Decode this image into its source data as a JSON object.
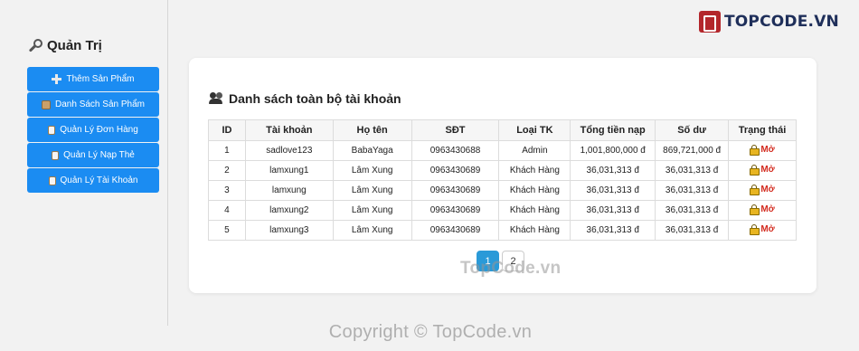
{
  "logo": {
    "text": "TOPCODE.VN"
  },
  "sidebar": {
    "title": "Quản Trị",
    "items": [
      {
        "label": "Thêm Sản Phẩm",
        "icon": "plus-icon"
      },
      {
        "label": "Danh Sách Sản Phẩm",
        "icon": "box-icon"
      },
      {
        "label": "Quản Lý Đơn Hàng",
        "icon": "clipboard-icon"
      },
      {
        "label": "Quản Lý Nạp Thẻ",
        "icon": "clipboard-icon"
      },
      {
        "label": "Quản Lý Tài Khoản",
        "icon": "clipboard-icon"
      }
    ]
  },
  "main": {
    "title": "Danh sách toàn bộ tài khoản",
    "columns": [
      "ID",
      "Tài khoản",
      "Họ tên",
      "SĐT",
      "Loại TK",
      "Tổng tiền nạp",
      "Số dư",
      "Trạng thái"
    ],
    "rows": [
      [
        "1",
        "sadlove123",
        "BabaYaga",
        "0963430688",
        "Admin",
        "1,001,800,000 đ",
        "869,721,000 đ",
        "Mở"
      ],
      [
        "2",
        "lamxung1",
        "Lâm Xung",
        "0963430689",
        "Khách Hàng",
        "36,031,313 đ",
        "36,031,313 đ",
        "Mở"
      ],
      [
        "3",
        "lamxung",
        "Lâm Xung",
        "0963430689",
        "Khách Hàng",
        "36,031,313 đ",
        "36,031,313 đ",
        "Mở"
      ],
      [
        "4",
        "lamxung2",
        "Lâm Xung",
        "0963430689",
        "Khách Hàng",
        "36,031,313 đ",
        "36,031,313 đ",
        "Mở"
      ],
      [
        "5",
        "lamxung3",
        "Lâm Xung",
        "0963430689",
        "Khách Hàng",
        "36,031,313 đ",
        "36,031,313 đ",
        "Mở"
      ]
    ],
    "pagination": [
      "1",
      "2"
    ],
    "active_page": "1"
  },
  "watermark": "TopCode.vn",
  "copyright": "Copyright © TopCode.vn",
  "colors": {
    "accent": "#1b8cf2",
    "status": "#d32b1f",
    "active_page": "#2a9ad8"
  }
}
